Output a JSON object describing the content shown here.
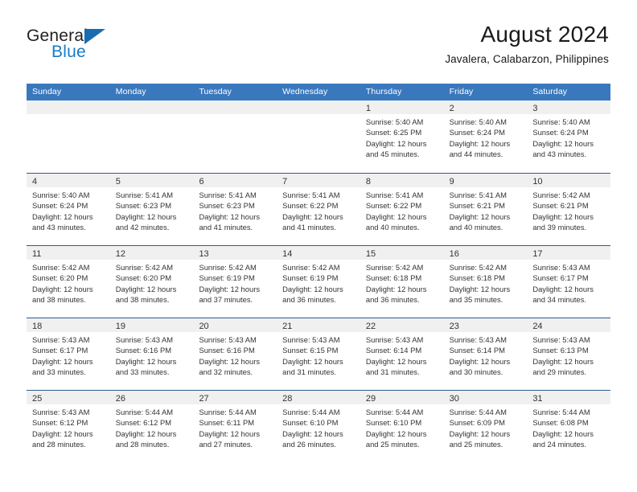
{
  "brand": {
    "name_top": "General",
    "name_bottom": "Blue",
    "triangle_color": "#1a6cb0",
    "text_color_top": "#231f20",
    "text_color_bottom": "#1a7bc4"
  },
  "header": {
    "title": "August 2024",
    "subtitle": "Javalera, Calabarzon, Philippines"
  },
  "colors": {
    "header_row_bg": "#3a78bd",
    "header_row_text": "#ffffff",
    "week_divider": "#2e5c8f",
    "date_band_bg": "#f0f0f0",
    "body_text": "#333333"
  },
  "day_headers": [
    "Sunday",
    "Monday",
    "Tuesday",
    "Wednesday",
    "Thursday",
    "Friday",
    "Saturday"
  ],
  "weeks": [
    [
      {
        "date": "",
        "empty": true,
        "sunrise": "",
        "sunset": "",
        "daylight_line1": "",
        "daylight_line2": ""
      },
      {
        "date": "",
        "empty": true,
        "sunrise": "",
        "sunset": "",
        "daylight_line1": "",
        "daylight_line2": ""
      },
      {
        "date": "",
        "empty": true,
        "sunrise": "",
        "sunset": "",
        "daylight_line1": "",
        "daylight_line2": ""
      },
      {
        "date": "",
        "empty": true,
        "sunrise": "",
        "sunset": "",
        "daylight_line1": "",
        "daylight_line2": ""
      },
      {
        "date": "1",
        "empty": false,
        "sunrise": "Sunrise: 5:40 AM",
        "sunset": "Sunset: 6:25 PM",
        "daylight_line1": "Daylight: 12 hours",
        "daylight_line2": "and 45 minutes."
      },
      {
        "date": "2",
        "empty": false,
        "sunrise": "Sunrise: 5:40 AM",
        "sunset": "Sunset: 6:24 PM",
        "daylight_line1": "Daylight: 12 hours",
        "daylight_line2": "and 44 minutes."
      },
      {
        "date": "3",
        "empty": false,
        "sunrise": "Sunrise: 5:40 AM",
        "sunset": "Sunset: 6:24 PM",
        "daylight_line1": "Daylight: 12 hours",
        "daylight_line2": "and 43 minutes."
      }
    ],
    [
      {
        "date": "4",
        "empty": false,
        "sunrise": "Sunrise: 5:40 AM",
        "sunset": "Sunset: 6:24 PM",
        "daylight_line1": "Daylight: 12 hours",
        "daylight_line2": "and 43 minutes."
      },
      {
        "date": "5",
        "empty": false,
        "sunrise": "Sunrise: 5:41 AM",
        "sunset": "Sunset: 6:23 PM",
        "daylight_line1": "Daylight: 12 hours",
        "daylight_line2": "and 42 minutes."
      },
      {
        "date": "6",
        "empty": false,
        "sunrise": "Sunrise: 5:41 AM",
        "sunset": "Sunset: 6:23 PM",
        "daylight_line1": "Daylight: 12 hours",
        "daylight_line2": "and 41 minutes."
      },
      {
        "date": "7",
        "empty": false,
        "sunrise": "Sunrise: 5:41 AM",
        "sunset": "Sunset: 6:22 PM",
        "daylight_line1": "Daylight: 12 hours",
        "daylight_line2": "and 41 minutes."
      },
      {
        "date": "8",
        "empty": false,
        "sunrise": "Sunrise: 5:41 AM",
        "sunset": "Sunset: 6:22 PM",
        "daylight_line1": "Daylight: 12 hours",
        "daylight_line2": "and 40 minutes."
      },
      {
        "date": "9",
        "empty": false,
        "sunrise": "Sunrise: 5:41 AM",
        "sunset": "Sunset: 6:21 PM",
        "daylight_line1": "Daylight: 12 hours",
        "daylight_line2": "and 40 minutes."
      },
      {
        "date": "10",
        "empty": false,
        "sunrise": "Sunrise: 5:42 AM",
        "sunset": "Sunset: 6:21 PM",
        "daylight_line1": "Daylight: 12 hours",
        "daylight_line2": "and 39 minutes."
      }
    ],
    [
      {
        "date": "11",
        "empty": false,
        "sunrise": "Sunrise: 5:42 AM",
        "sunset": "Sunset: 6:20 PM",
        "daylight_line1": "Daylight: 12 hours",
        "daylight_line2": "and 38 minutes."
      },
      {
        "date": "12",
        "empty": false,
        "sunrise": "Sunrise: 5:42 AM",
        "sunset": "Sunset: 6:20 PM",
        "daylight_line1": "Daylight: 12 hours",
        "daylight_line2": "and 38 minutes."
      },
      {
        "date": "13",
        "empty": false,
        "sunrise": "Sunrise: 5:42 AM",
        "sunset": "Sunset: 6:19 PM",
        "daylight_line1": "Daylight: 12 hours",
        "daylight_line2": "and 37 minutes."
      },
      {
        "date": "14",
        "empty": false,
        "sunrise": "Sunrise: 5:42 AM",
        "sunset": "Sunset: 6:19 PM",
        "daylight_line1": "Daylight: 12 hours",
        "daylight_line2": "and 36 minutes."
      },
      {
        "date": "15",
        "empty": false,
        "sunrise": "Sunrise: 5:42 AM",
        "sunset": "Sunset: 6:18 PM",
        "daylight_line1": "Daylight: 12 hours",
        "daylight_line2": "and 36 minutes."
      },
      {
        "date": "16",
        "empty": false,
        "sunrise": "Sunrise: 5:42 AM",
        "sunset": "Sunset: 6:18 PM",
        "daylight_line1": "Daylight: 12 hours",
        "daylight_line2": "and 35 minutes."
      },
      {
        "date": "17",
        "empty": false,
        "sunrise": "Sunrise: 5:43 AM",
        "sunset": "Sunset: 6:17 PM",
        "daylight_line1": "Daylight: 12 hours",
        "daylight_line2": "and 34 minutes."
      }
    ],
    [
      {
        "date": "18",
        "empty": false,
        "sunrise": "Sunrise: 5:43 AM",
        "sunset": "Sunset: 6:17 PM",
        "daylight_line1": "Daylight: 12 hours",
        "daylight_line2": "and 33 minutes."
      },
      {
        "date": "19",
        "empty": false,
        "sunrise": "Sunrise: 5:43 AM",
        "sunset": "Sunset: 6:16 PM",
        "daylight_line1": "Daylight: 12 hours",
        "daylight_line2": "and 33 minutes."
      },
      {
        "date": "20",
        "empty": false,
        "sunrise": "Sunrise: 5:43 AM",
        "sunset": "Sunset: 6:16 PM",
        "daylight_line1": "Daylight: 12 hours",
        "daylight_line2": "and 32 minutes."
      },
      {
        "date": "21",
        "empty": false,
        "sunrise": "Sunrise: 5:43 AM",
        "sunset": "Sunset: 6:15 PM",
        "daylight_line1": "Daylight: 12 hours",
        "daylight_line2": "and 31 minutes."
      },
      {
        "date": "22",
        "empty": false,
        "sunrise": "Sunrise: 5:43 AM",
        "sunset": "Sunset: 6:14 PM",
        "daylight_line1": "Daylight: 12 hours",
        "daylight_line2": "and 31 minutes."
      },
      {
        "date": "23",
        "empty": false,
        "sunrise": "Sunrise: 5:43 AM",
        "sunset": "Sunset: 6:14 PM",
        "daylight_line1": "Daylight: 12 hours",
        "daylight_line2": "and 30 minutes."
      },
      {
        "date": "24",
        "empty": false,
        "sunrise": "Sunrise: 5:43 AM",
        "sunset": "Sunset: 6:13 PM",
        "daylight_line1": "Daylight: 12 hours",
        "daylight_line2": "and 29 minutes."
      }
    ],
    [
      {
        "date": "25",
        "empty": false,
        "sunrise": "Sunrise: 5:43 AM",
        "sunset": "Sunset: 6:12 PM",
        "daylight_line1": "Daylight: 12 hours",
        "daylight_line2": "and 28 minutes."
      },
      {
        "date": "26",
        "empty": false,
        "sunrise": "Sunrise: 5:44 AM",
        "sunset": "Sunset: 6:12 PM",
        "daylight_line1": "Daylight: 12 hours",
        "daylight_line2": "and 28 minutes."
      },
      {
        "date": "27",
        "empty": false,
        "sunrise": "Sunrise: 5:44 AM",
        "sunset": "Sunset: 6:11 PM",
        "daylight_line1": "Daylight: 12 hours",
        "daylight_line2": "and 27 minutes."
      },
      {
        "date": "28",
        "empty": false,
        "sunrise": "Sunrise: 5:44 AM",
        "sunset": "Sunset: 6:10 PM",
        "daylight_line1": "Daylight: 12 hours",
        "daylight_line2": "and 26 minutes."
      },
      {
        "date": "29",
        "empty": false,
        "sunrise": "Sunrise: 5:44 AM",
        "sunset": "Sunset: 6:10 PM",
        "daylight_line1": "Daylight: 12 hours",
        "daylight_line2": "and 25 minutes."
      },
      {
        "date": "30",
        "empty": false,
        "sunrise": "Sunrise: 5:44 AM",
        "sunset": "Sunset: 6:09 PM",
        "daylight_line1": "Daylight: 12 hours",
        "daylight_line2": "and 25 minutes."
      },
      {
        "date": "31",
        "empty": false,
        "sunrise": "Sunrise: 5:44 AM",
        "sunset": "Sunset: 6:08 PM",
        "daylight_line1": "Daylight: 12 hours",
        "daylight_line2": "and 24 minutes."
      }
    ]
  ]
}
